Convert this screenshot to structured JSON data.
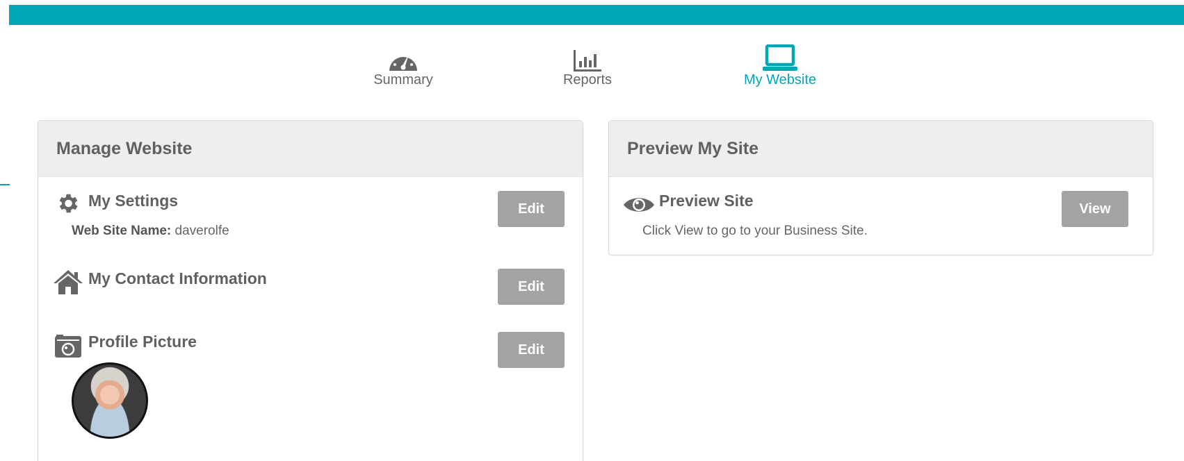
{
  "nav": {
    "items": [
      {
        "label": "Summary",
        "icon": "speedometer-icon"
      },
      {
        "label": "Reports",
        "icon": "bar-chart-icon"
      },
      {
        "label": "My Website",
        "icon": "laptop-icon"
      }
    ],
    "active_color": "#00a7b5"
  },
  "manage": {
    "title": "Manage Website",
    "settings": {
      "title": "My Settings",
      "site_name_label": "Web Site Name:",
      "site_name_value": "daverolfe",
      "button": "Edit"
    },
    "contact": {
      "title": "My Contact Information",
      "button": "Edit"
    },
    "profile": {
      "title": "Profile Picture",
      "button": "Edit"
    }
  },
  "preview": {
    "title": "Preview My Site",
    "site": {
      "title": "Preview Site",
      "description": "Click View to go to your Business Site.",
      "button": "View"
    }
  },
  "colors": {
    "accent": "#00a7b5",
    "button": "#a3a3a3",
    "panel_header": "#eeeeee"
  }
}
